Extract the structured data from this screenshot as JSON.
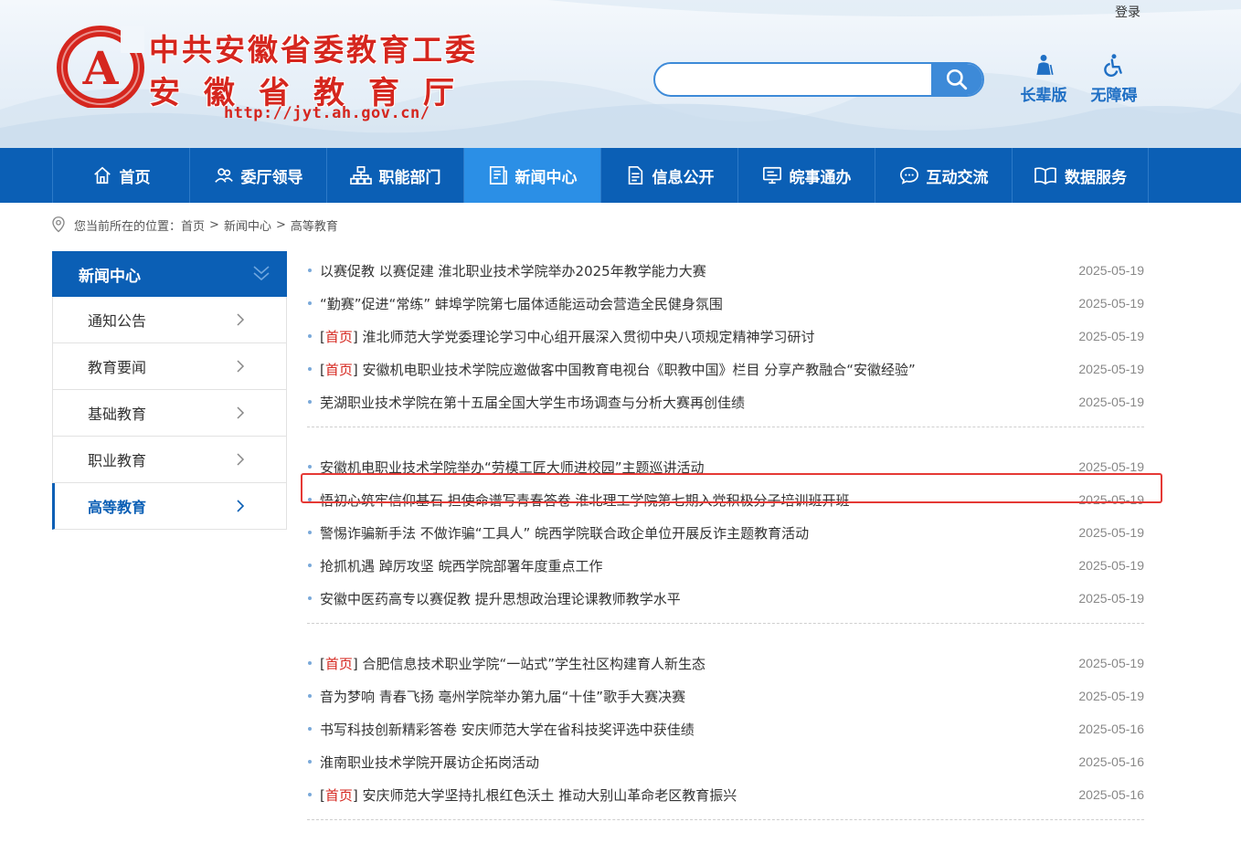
{
  "header": {
    "login_label": "登录",
    "title_line1": "中共安徽省委教育工委",
    "title_line2": "安徽省教育厅",
    "site_url": "http://jyt.ah.gov.cn/",
    "search_placeholder": "",
    "tools": [
      {
        "label": "长辈版",
        "icon": "elder-icon"
      },
      {
        "label": "无障碍",
        "icon": "wheelchair-icon"
      }
    ]
  },
  "nav": {
    "items": [
      {
        "label": "首页",
        "icon": "home-icon"
      },
      {
        "label": "委厅领导",
        "icon": "leaders-icon"
      },
      {
        "label": "职能部门",
        "icon": "org-chart-icon"
      },
      {
        "label": "新闻中心",
        "icon": "news-icon",
        "active": true
      },
      {
        "label": "信息公开",
        "icon": "document-icon"
      },
      {
        "label": "皖事通办",
        "icon": "monitor-icon"
      },
      {
        "label": "互动交流",
        "icon": "chat-icon"
      },
      {
        "label": "数据服务",
        "icon": "book-icon"
      }
    ]
  },
  "breadcrumb": {
    "prefix": "您当前所在的位置：",
    "items": [
      "首页",
      "新闻中心",
      "高等教育"
    ],
    "separator": ">"
  },
  "sidebar": {
    "heading": "新闻中心",
    "items": [
      {
        "label": "通知公告"
      },
      {
        "label": "教育要闻"
      },
      {
        "label": "基础教育"
      },
      {
        "label": "职业教育"
      },
      {
        "label": "高等教育",
        "active": true
      }
    ]
  },
  "news": {
    "tag_label": "首页",
    "groups": [
      [
        {
          "tag": "",
          "title": "以赛促教 以赛促建 淮北职业技术学院举办2025年教学能力大赛",
          "date": "2025-05-19"
        },
        {
          "tag": "",
          "title": "“勤赛”促进“常练” 蚌埠学院第七届体适能运动会营造全民健身氛围",
          "date": "2025-05-19"
        },
        {
          "tag": "首页",
          "title": "淮北师范大学党委理论学习中心组开展深入贯彻中央八项规定精神学习研讨",
          "date": "2025-05-19"
        },
        {
          "tag": "首页",
          "title": "安徽机电职业技术学院应邀做客中国教育电视台《职教中国》栏目 分享产教融合“安徽经验”",
          "date": "2025-05-19"
        },
        {
          "tag": "",
          "title": "芜湖职业技术学院在第十五届全国大学生市场调查与分析大赛再创佳绩",
          "date": "2025-05-19"
        }
      ],
      [
        {
          "tag": "",
          "title": "安徽机电职业技术学院举办“劳模工匠大师进校园”主题巡讲活动",
          "date": "2025-05-19"
        },
        {
          "tag": "",
          "title": "悟初心筑牢信仰基石 担使命谱写青春答卷 淮北理工学院第七期入党积极分子培训班开班",
          "date": "2025-05-19"
        },
        {
          "tag": "",
          "title": "警惕诈骗新手法 不做诈骗“工具人” 皖西学院联合政企单位开展反诈主题教育活动",
          "date": "2025-05-19"
        },
        {
          "tag": "",
          "title": "抢抓机遇 踔厉攻坚 皖西学院部署年度重点工作",
          "date": "2025-05-19"
        },
        {
          "tag": "",
          "title": "安徽中医药高专以赛促教 提升思想政治理论课教师教学水平",
          "date": "2025-05-19"
        }
      ],
      [
        {
          "tag": "首页",
          "title": "合肥信息技术职业学院“一站式”学生社区构建育人新生态",
          "date": "2025-05-19"
        },
        {
          "tag": "",
          "title": "音为梦响 青春飞扬 亳州学院举办第九届“十佳”歌手大赛决赛",
          "date": "2025-05-19"
        },
        {
          "tag": "",
          "title": "书写科技创新精彩答卷 安庆师范大学在省科技奖评选中获佳绩",
          "date": "2025-05-16"
        },
        {
          "tag": "",
          "title": "淮南职业技术学院开展访企拓岗活动",
          "date": "2025-05-16"
        },
        {
          "tag": "首页",
          "title": "安庆师范大学坚持扎根红色沃土 推动大别山革命老区教育振兴",
          "date": "2025-05-16"
        }
      ]
    ]
  },
  "colors": {
    "brand_blue": "#0b5fb5",
    "nav_active": "#2b8fe6",
    "title_red": "#d5261e",
    "highlight_red": "#e53935"
  }
}
